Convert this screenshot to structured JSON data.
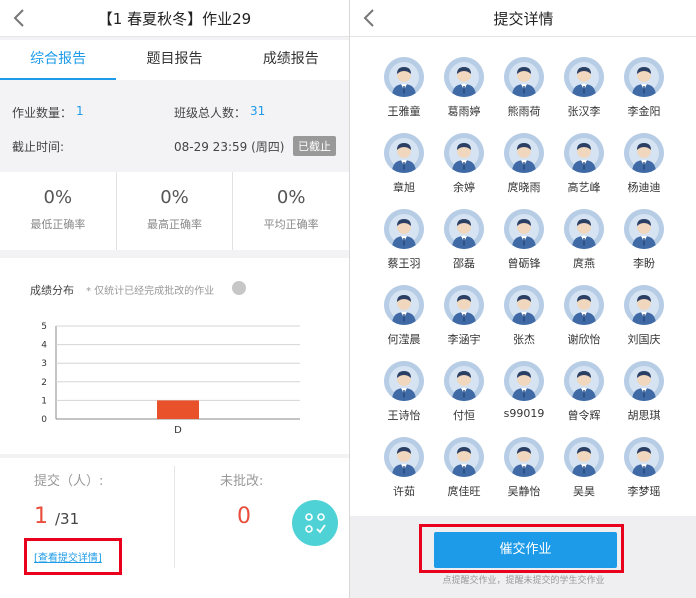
{
  "left": {
    "title": "【1 春夏秋冬】作业29",
    "tabs": [
      "综合报告",
      "题目报告",
      "成绩报告"
    ],
    "info": {
      "homework_count_label": "作业数量：",
      "homework_count": "1",
      "class_total_label": "班级总人数：",
      "class_total": "31",
      "deadline_label": "截止时间:",
      "deadline_value": "08-29 23:59 (周四)",
      "deadline_badge": "已截止"
    },
    "rates": [
      {
        "value": "0%",
        "label": "最低正确率"
      },
      {
        "value": "0%",
        "label": "最高正确率"
      },
      {
        "value": "0%",
        "label": "平均正确率"
      }
    ],
    "distribution": {
      "title": "成绩分布",
      "note": "* 仅统计已经完成批改的作业"
    },
    "submit": {
      "label": "提交（人）:",
      "count": "1",
      "total": "/31",
      "detail_link": "[查看提交详情]",
      "unmarked_label": "未批改:",
      "unmarked_count": "0"
    }
  },
  "chart_data": {
    "type": "bar",
    "categories": [
      "D"
    ],
    "values": [
      1
    ],
    "ylim": [
      0,
      5
    ],
    "yticks": [
      0,
      1,
      2,
      3,
      4,
      5
    ],
    "grid": true,
    "bar_color": "#e8512a"
  },
  "right": {
    "title": "提交详情",
    "students": [
      "王雅童",
      "葛雨婷",
      "熊雨荷",
      "张汉李",
      "李金阳",
      "章旭",
      "余婷",
      "庹晓雨",
      "高艺峰",
      "杨迪迪",
      "蔡王羽",
      "邵磊",
      "曾砺锋",
      "庹燕",
      "李盼",
      "何滢晨",
      "李涵宇",
      "张杰",
      "谢欣怡",
      "刘国庆",
      "王诗怡",
      "付恒",
      "s99019",
      "曾令辉",
      "胡思琪",
      "许茹",
      "庹佳旺",
      "吴静怡",
      "吴昊",
      "李梦瑶"
    ],
    "remind_button": "催交作业",
    "remind_hint": "点提醒交作业，提醒未提交的学生交作业"
  },
  "colors": {
    "accent": "#1e9be8",
    "red": "#e94e3d",
    "teal": "#4fd2d5"
  }
}
